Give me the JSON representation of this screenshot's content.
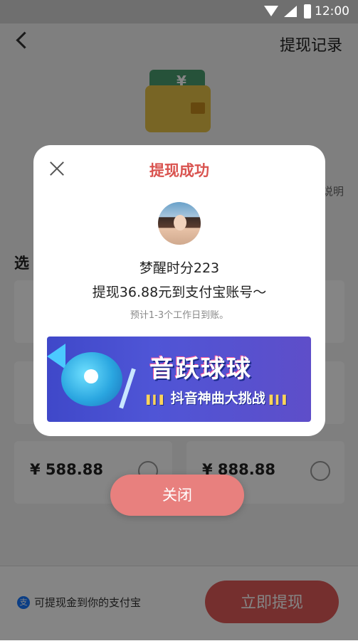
{
  "status_bar": {
    "time": "12:00"
  },
  "header": {
    "record_link": "提现记录"
  },
  "wallet_icon": {
    "symbol": "¥"
  },
  "rules_link": "说明",
  "choose_label": "选",
  "options": [
    {
      "amount": "¥ 588.88"
    },
    {
      "amount": "¥ 888.88"
    }
  ],
  "bottom": {
    "alipay_icon_glyph": "支",
    "alipay_tip": "可提现金到你的支付宝",
    "withdraw_label": "立即提现"
  },
  "modal": {
    "title": "提现成功",
    "user_name": "梦醒时分223",
    "success_message": "提现36.88元到支付宝账号～",
    "eta_note": "预计1-3个工作日到账。",
    "banner": {
      "title": "音跃球球",
      "subtitle": "抖音神曲大挑战"
    },
    "close_label": "关闭"
  }
}
